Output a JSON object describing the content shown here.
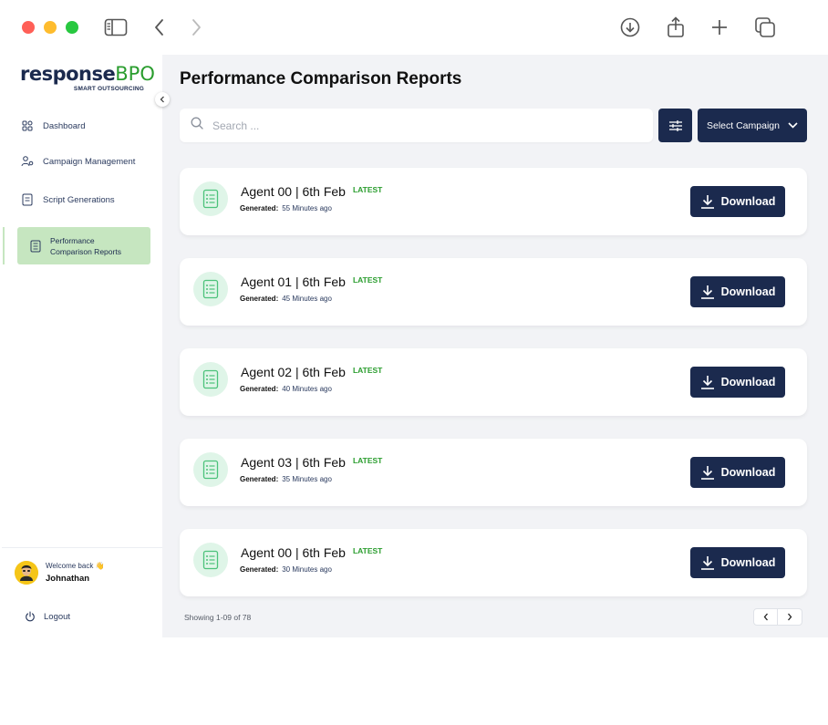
{
  "browser": {
    "icons": [
      "sidebar-toggle-icon",
      "back-icon",
      "forward-icon",
      "downloads-icon",
      "share-icon",
      "new-tab-icon",
      "tabs-overview-icon"
    ]
  },
  "brand": {
    "name_main": "response",
    "name_accent": "BPO",
    "tagline": "SMART OUTSOURCING",
    "colors": {
      "navy": "#1b2a4e",
      "green": "#2a9d2e",
      "active_bg": "#c6e6c0"
    }
  },
  "sidebar": {
    "items": [
      {
        "label": "Dashboard",
        "icon": "dashboard-icon"
      },
      {
        "label": "Campaign Management",
        "icon": "campaign-icon"
      },
      {
        "label": "Script Generations",
        "icon": "script-icon"
      },
      {
        "label": "Performance Comparison Reports",
        "icon": "report-icon",
        "active": true
      }
    ],
    "user": {
      "welcome": "Welcome back 👋",
      "name": "Johnathan"
    },
    "logout_label": "Logout"
  },
  "main": {
    "title": "Performance Comparison Reports",
    "search_placeholder": "Search ...",
    "campaign_select_label": "Select Campaign",
    "reports": [
      {
        "title": "Agent 00 | 6th Feb",
        "badge": "LATEST",
        "generated_label": "Generated:",
        "generated_value": "55 Minutes ago",
        "download_label": "Download"
      },
      {
        "title": "Agent 01 | 6th Feb",
        "badge": "LATEST",
        "generated_label": "Generated:",
        "generated_value": "45 Minutes ago",
        "download_label": "Download"
      },
      {
        "title": "Agent 02 | 6th Feb",
        "badge": "LATEST",
        "generated_label": "Generated:",
        "generated_value": "40 Minutes ago",
        "download_label": "Download"
      },
      {
        "title": "Agent 03 | 6th Feb",
        "badge": "LATEST",
        "generated_label": "Generated:",
        "generated_value": "35 Minutes ago",
        "download_label": "Download"
      },
      {
        "title": "Agent 00 | 6th Feb",
        "badge": "LATEST",
        "generated_label": "Generated:",
        "generated_value": "30 Minutes ago",
        "download_label": "Download"
      }
    ],
    "pagination_text": "Showing 1-09 of 78"
  }
}
